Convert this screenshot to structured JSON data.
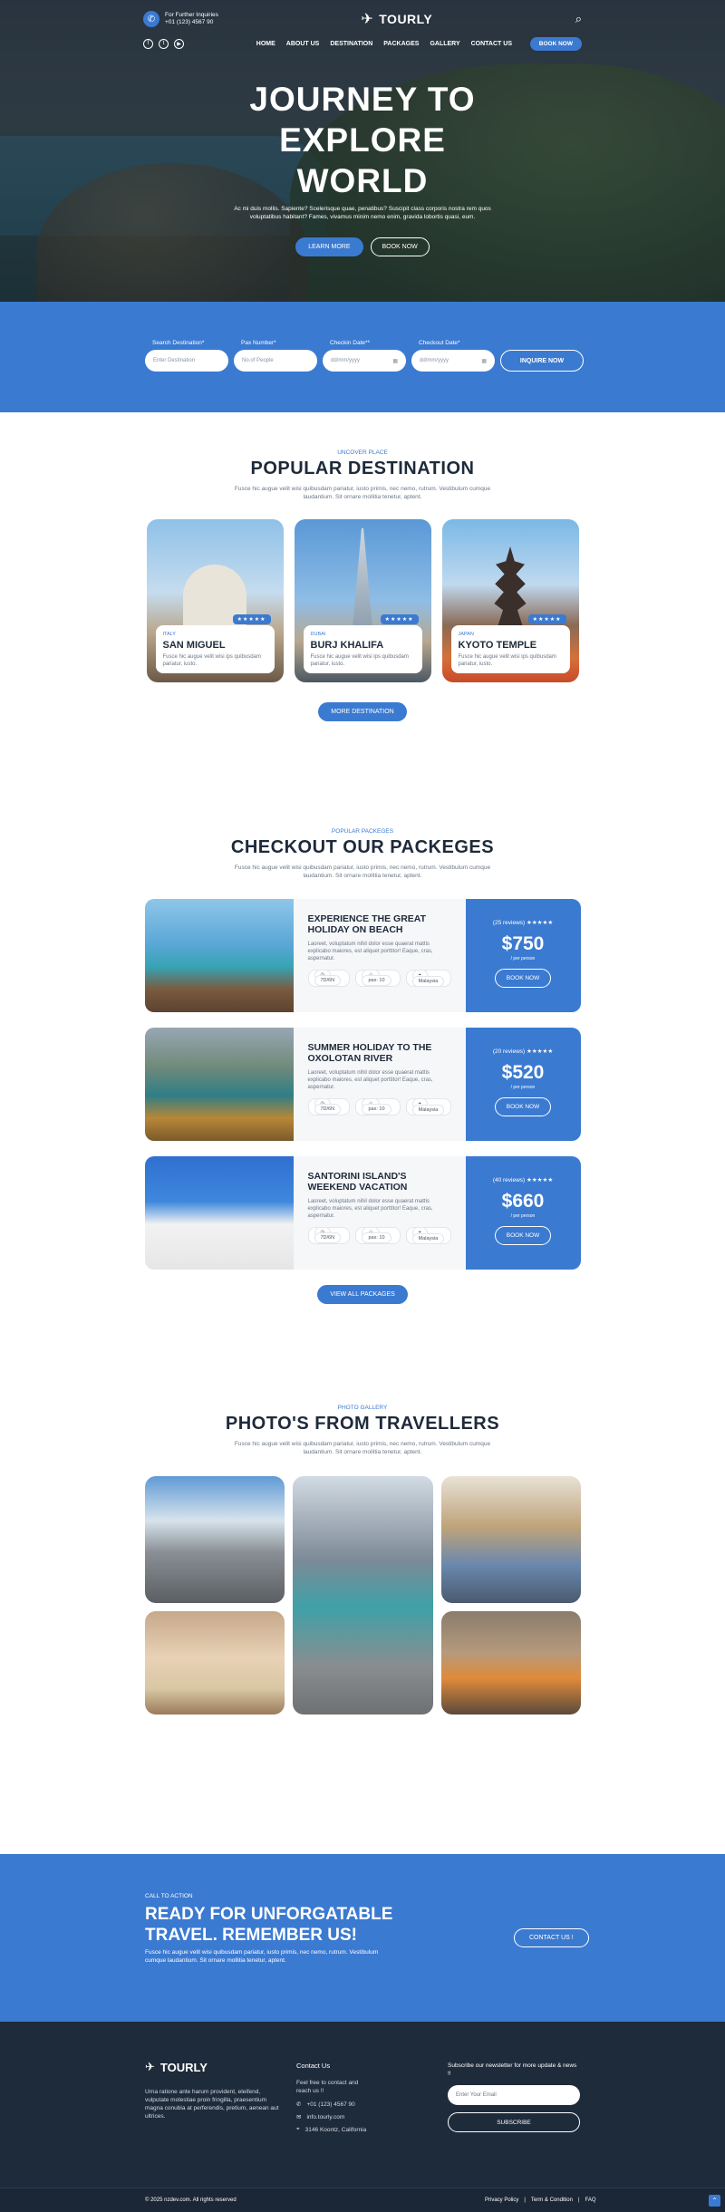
{
  "header": {
    "inquiry_label": "For Further Inquiries",
    "phone": "+01 (123) 4567 90",
    "logo": "TOURLY",
    "nav": [
      "HOME",
      "ABOUT US",
      "DESTINATION",
      "PACKAGES",
      "GALLERY",
      "CONTACT US"
    ],
    "book_now": "BOOK NOW",
    "icons": [
      "phone-icon",
      "facebook-icon",
      "twitter-icon",
      "youtube-icon",
      "search-icon"
    ]
  },
  "hero": {
    "title_line1": "JOURNEY TO",
    "title_line2": "EXPLORE",
    "title_line3": "WORLD",
    "subtitle": "Ac mi duis mollis. Sapiente? Scelerisque quae, penatibus? Suscipit class corporis nostra rem quos voluptatibus habitant? Fames, vivamus minim nemo enim, gravida lobortis quasi, eum.",
    "learn_more": "LEARN MORE",
    "book_now": "BOOK NOW"
  },
  "booking": {
    "fields": [
      {
        "label": "Search Destination*",
        "placeholder": "Enter Destination"
      },
      {
        "label": "Pax Number*",
        "placeholder": "No.of People"
      },
      {
        "label": "Checkin Date**",
        "placeholder": "dd/mm/yyyy"
      },
      {
        "label": "Checkout Date*",
        "placeholder": "dd/mm/yyyy"
      }
    ],
    "submit": "INQUIRE NOW"
  },
  "destinations": {
    "tag": "UNCOVER PLACE",
    "title": "POPULAR DESTINATION",
    "subtitle": "Fusce hic augue velit wisi quibusdam pariatur, iusto primis, nec nemo, rutrum. Vestibulum cumque laudantium. Sit ornare mollitia tenetur, aptent.",
    "items": [
      {
        "country": "ITALY",
        "name": "SAN MIGUEL",
        "desc": "Fusce hic augue velit wisi ips quibusdam pariatur, iusto.",
        "rating": "★★★★★"
      },
      {
        "country": "DUBAI",
        "name": "BURJ KHALIFA",
        "desc": "Fusce hic augue velit wisi ips quibusdam pariatur, iusto.",
        "rating": "★★★★★"
      },
      {
        "country": "JAPAN",
        "name": "KYOTO TEMPLE",
        "desc": "Fusce hic augue velit wisi ips quibusdam pariatur, iusto.",
        "rating": "★★★★★"
      }
    ],
    "more_button": "MORE DESTINATION"
  },
  "packages": {
    "tag": "POPULAR PACKEGES",
    "title": "CHECKOUT OUR PACKEGES",
    "subtitle": "Fusce hic augue velit wisi quibusdam pariatur, iusto primis, nec nemo, rutrum. Vestibulum cumque laudantium. Sit ornare mollitia tenetur, aptent.",
    "items": [
      {
        "title": "EXPERIENCE THE GREAT HOLIDAY ON BEACH",
        "desc": "Laoreet, voluptatum nihil dolor esse quaerat mattis explicabo maiores, est aliquet porttitor! Eaque, cras, aspernatur.",
        "days": "7D/6N",
        "pax": "pax: 10",
        "location": "Malaysia",
        "reviews": "(25 reviews)",
        "stars": "★★★★★",
        "price": "$750",
        "per": "/ per person",
        "button": "BOOK NOW"
      },
      {
        "title": "SUMMER HOLIDAY TO THE OXOLOTAN RIVER",
        "desc": "Laoreet, voluptatum nihil dolor esse quaerat mattis explicabo maiores, est aliquet porttitor! Eaque, cras, aspernatur.",
        "days": "7D/6N",
        "pax": "pax: 10",
        "location": "Malaysia",
        "reviews": "(20 reviews)",
        "stars": "★★★★★",
        "price": "$520",
        "per": "/ per person",
        "button": "BOOK NOW"
      },
      {
        "title": "SANTORINI ISLAND'S WEEKEND VACATION",
        "desc": "Laoreet, voluptatum nihil dolor esse quaerat mattis explicabo maiores, est aliquet porttitor! Eaque, cras, aspernatur.",
        "days": "7D/6N",
        "pax": "pax: 10",
        "location": "Malaysia",
        "reviews": "(40 reviews)",
        "stars": "★★★★★",
        "price": "$660",
        "per": "/ per person",
        "button": "BOOK NOW"
      }
    ],
    "view_all": "VIEW ALL PACKAGES"
  },
  "gallery": {
    "tag": "PHOTO GALLERY",
    "title": "PHOTO'S FROM TRAVELLERS",
    "subtitle": "Fusce hic augue velit wisi quibusdam pariatur, iusto primis, nec nemo, rutrum. Vestibulum cumque laudantium. Sit ornare mollitia tenetur, aptent."
  },
  "cta": {
    "tag": "CALL TO ACTION",
    "title_line1": "READY FOR UNFORGATABLE",
    "title_line2": "TRAVEL. REMEMBER US!",
    "text": "Fusce hic augue velit wisi quibusdam pariatur, iusto primis, nec nemo, rutrum. Vestibulum cumque laudantium. Sit ornare mollitia tenetur, aptent.",
    "button": "CONTACT US !"
  },
  "footer": {
    "logo": "TOURLY",
    "about": "Urna ratione ante harum provident, eleifend, vulputate molestiae proin fringilla, praesentium magna conubia at perferendis, pretium, aenean aut ultrices.",
    "contact_heading": "Contact Us",
    "contact_text": "Feel free to contact and reach us !!",
    "phone": "+01 (123) 4567 90",
    "email": "info.tourly.com",
    "address": "3146 Koontz, California",
    "newsletter_text": "Subscribe our newsletter for more update & news !!",
    "email_placeholder": "Enter Your Email",
    "subscribe": "SUBSCRIBE",
    "copyright": "© 2025 nzdev.com. All rights reserved",
    "links": [
      "Privacy Policy",
      "|",
      "Term & Condition",
      "|",
      "FAQ"
    ]
  },
  "colors": {
    "accent": "#3b7ad1",
    "dark": "#1e2b3b"
  }
}
